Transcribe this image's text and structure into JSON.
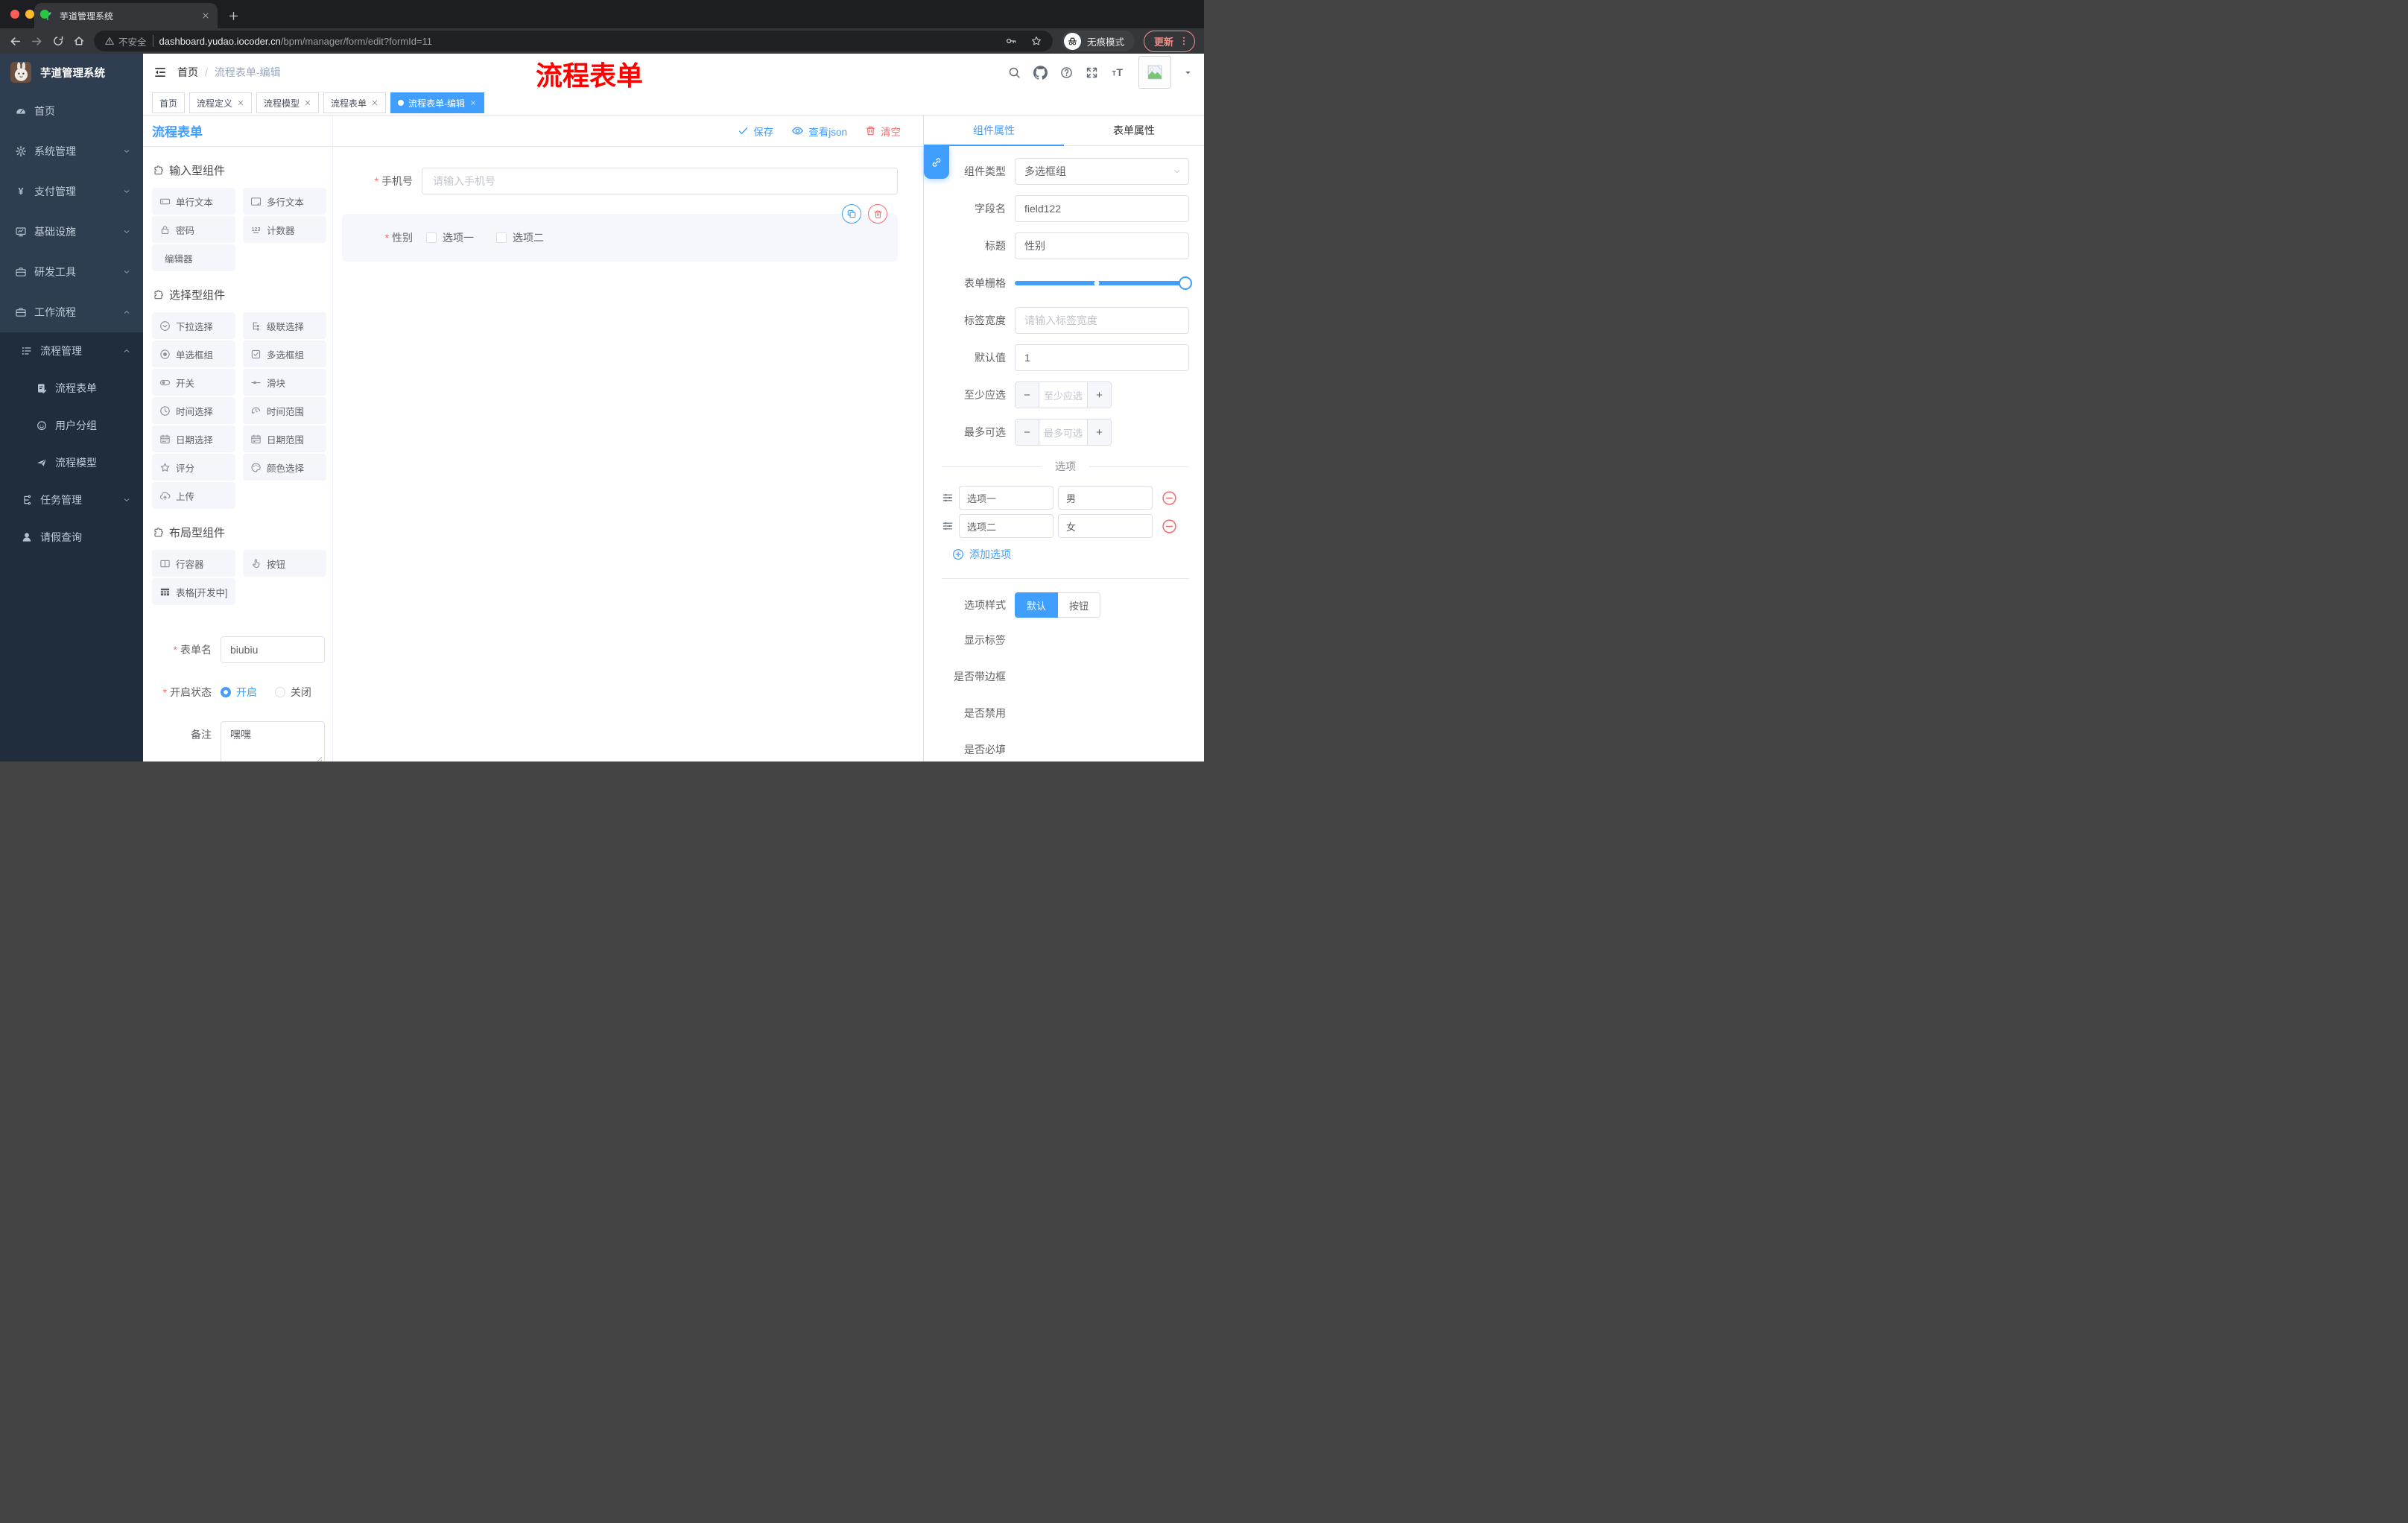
{
  "colors": {
    "primary": "#409EFF",
    "danger": "#F56C6C",
    "watermark": "#FF0000",
    "sidebar_bg": "#2E3D4F",
    "submenu_bg": "#1F2D3D"
  },
  "browser": {
    "tab_title": "芋道管理系统",
    "security_label": "不安全",
    "url_host": "dashboard.yudao.iocoder.cn",
    "url_path": "/bpm/manager/form/edit?formId=11",
    "incognito_label": "无痕模式",
    "update_label": "更新"
  },
  "sidebar": {
    "logo_title": "芋道管理系统",
    "menu": [
      {
        "name": "home",
        "label": "首页",
        "icon": "dashboard",
        "chevron": "",
        "level": 1,
        "sub": false
      },
      {
        "name": "system-mgmt",
        "label": "系统管理",
        "icon": "gear",
        "chevron": "down",
        "level": 1,
        "sub": false
      },
      {
        "name": "payment-mgmt",
        "label": "支付管理",
        "icon": "yen",
        "chevron": "down",
        "level": 1,
        "sub": false
      },
      {
        "name": "infrastructure",
        "label": "基础设施",
        "icon": "monitor",
        "chevron": "down",
        "level": 1,
        "sub": false
      },
      {
        "name": "dev-tools",
        "label": "研发工具",
        "icon": "briefcase",
        "chevron": "down",
        "level": 1,
        "sub": false
      },
      {
        "name": "workflow",
        "label": "工作流程",
        "icon": "briefcase",
        "chevron": "up",
        "level": 1,
        "sub": false
      },
      {
        "name": "process-mgmt",
        "label": "流程管理",
        "icon": "listtree",
        "chevron": "up",
        "level": 2,
        "sub": true
      },
      {
        "name": "process-form",
        "label": "流程表单",
        "icon": "docedit",
        "chevron": "",
        "level": 3,
        "sub": true
      },
      {
        "name": "user-group",
        "label": "用户分组",
        "icon": "face",
        "chevron": "",
        "level": 3,
        "sub": true
      },
      {
        "name": "process-model",
        "label": "流程模型",
        "icon": "plane",
        "chevron": "",
        "level": 3,
        "sub": true
      },
      {
        "name": "task-mgmt",
        "label": "任务管理",
        "icon": "tree",
        "chevron": "down",
        "level": 2,
        "sub": true
      },
      {
        "name": "leave-query",
        "label": "请假查询",
        "icon": "user",
        "chevron": "",
        "level": 2,
        "sub": true
      }
    ]
  },
  "header": {
    "breadcrumb_home": "首页",
    "breadcrumb_current": "流程表单-编辑",
    "watermark": "流程表单"
  },
  "tags": [
    {
      "name": "home",
      "label": "首页",
      "closable": false,
      "active": false
    },
    {
      "name": "process-definition",
      "label": "流程定义",
      "closable": true,
      "active": false
    },
    {
      "name": "process-model",
      "label": "流程模型",
      "closable": true,
      "active": false
    },
    {
      "name": "process-form",
      "label": "流程表单",
      "closable": true,
      "active": false
    },
    {
      "name": "process-form-edit",
      "label": "流程表单-编辑",
      "closable": true,
      "active": true
    }
  ],
  "panel": {
    "title": "流程表单",
    "groups": [
      {
        "title": "输入型组件",
        "icon": "puzzle",
        "items": [
          {
            "name": "single-line-text",
            "label": "单行文本",
            "icon": "input"
          },
          {
            "name": "multi-line-text",
            "label": "多行文本",
            "icon": "textarea"
          },
          {
            "name": "password",
            "label": "密码",
            "icon": "lock"
          },
          {
            "name": "counter",
            "label": "计数器",
            "icon": "counter"
          },
          {
            "name": "editor",
            "label": "编辑器",
            "icon": ""
          }
        ]
      },
      {
        "title": "选择型组件",
        "icon": "puzzle",
        "items": [
          {
            "name": "select",
            "label": "下拉选择",
            "icon": "selectdown"
          },
          {
            "name": "cascader",
            "label": "级联选择",
            "icon": "cascade"
          },
          {
            "name": "radio-group",
            "label": "单选框组",
            "icon": "radioic"
          },
          {
            "name": "checkbox-group",
            "label": "多选框组",
            "icon": "checkboxic"
          },
          {
            "name": "switch",
            "label": "开关",
            "icon": "switchic"
          },
          {
            "name": "slider",
            "label": "滑块",
            "icon": "slideric"
          },
          {
            "name": "time-picker",
            "label": "时间选择",
            "icon": "clock"
          },
          {
            "name": "time-range",
            "label": "时间范围",
            "icon": "clockrange"
          },
          {
            "name": "date-picker",
            "label": "日期选择",
            "icon": "calendar"
          },
          {
            "name": "date-range",
            "label": "日期范围",
            "icon": "calrange"
          },
          {
            "name": "rate",
            "label": "评分",
            "icon": "star"
          },
          {
            "name": "color-picker",
            "label": "颜色选择",
            "icon": "palette"
          },
          {
            "name": "upload",
            "label": "上传",
            "icon": "upload"
          }
        ]
      },
      {
        "title": "布局型组件",
        "icon": "puzzle",
        "items": [
          {
            "name": "row-container",
            "label": "行容器",
            "icon": "rowbox"
          },
          {
            "name": "button",
            "label": "按钮",
            "icon": "pointer"
          },
          {
            "name": "table-dev",
            "label": "表格[开发中]",
            "icon": "tableic"
          }
        ]
      }
    ],
    "meta": {
      "form_name_label": "表单名",
      "form_name_value": "biubiu",
      "status_label": "开启状态",
      "status_on": "开启",
      "status_off": "关闭",
      "remark_label": "备注",
      "remark_value": "嘿嘿"
    }
  },
  "canvas": {
    "toolbar": {
      "save": "保存",
      "view_json": "查看json",
      "clear": "清空"
    },
    "phone": {
      "label": "手机号",
      "placeholder": "请输入手机号"
    },
    "gender": {
      "label": "性别",
      "option1": "选项一",
      "option2": "选项二"
    }
  },
  "props": {
    "tab_component": "组件属性",
    "tab_form": "表单属性",
    "rows": [
      {
        "name": "component-type",
        "label": "组件类型",
        "type": "select",
        "value": "多选框组"
      },
      {
        "name": "field-name",
        "label": "字段名",
        "type": "input",
        "value": "field122"
      },
      {
        "name": "title",
        "label": "标题",
        "type": "input",
        "value": "性别"
      },
      {
        "name": "form-grid",
        "label": "表单栅格",
        "type": "slider"
      },
      {
        "name": "label-width",
        "label": "标签宽度",
        "type": "input",
        "value": "",
        "placeholder": "请输入标签宽度"
      },
      {
        "name": "default-value",
        "label": "默认值",
        "type": "input",
        "value": "1"
      },
      {
        "name": "min-select",
        "label": "至少应选",
        "type": "stepper",
        "placeholder": "至少应选"
      },
      {
        "name": "max-select",
        "label": "最多可选",
        "type": "stepper",
        "placeholder": "最多可选"
      }
    ],
    "options_title": "选项",
    "options": [
      {
        "label": "选项一",
        "value": "男"
      },
      {
        "label": "选项二",
        "value": "女"
      }
    ],
    "add_option": "添加选项",
    "style_label": "选项样式",
    "style_options": [
      "默认",
      "按钮"
    ],
    "style_active": "默认",
    "switches": [
      {
        "name": "show-label",
        "label": "显示标签",
        "on": true
      },
      {
        "name": "with-border",
        "label": "是否带边框",
        "on": false
      },
      {
        "name": "disabled",
        "label": "是否禁用",
        "on": false
      },
      {
        "name": "required",
        "label": "是否必填",
        "on": true
      }
    ]
  }
}
